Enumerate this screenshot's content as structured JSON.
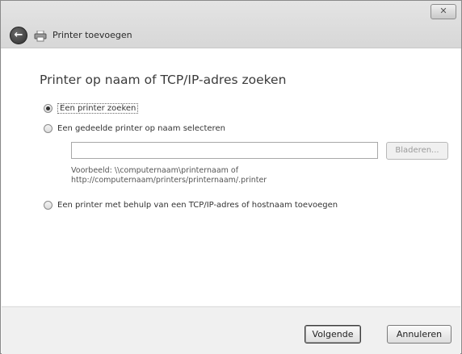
{
  "window": {
    "title": "Printer toevoegen",
    "close_glyph": "✕"
  },
  "main": {
    "heading": "Printer op naam of TCP/IP-adres zoeken",
    "options": [
      {
        "label": "Een printer zoeken",
        "selected": true
      },
      {
        "label": "Een gedeelde printer op naam selecteren",
        "selected": false
      },
      {
        "label": "Een printer met behulp van een TCP/IP-adres of hostnaam toevoegen",
        "selected": false
      }
    ],
    "path_input": {
      "value": ""
    },
    "browse_label": "Bladeren...",
    "example_line1": "Voorbeeld: \\\\computernaam\\printernaam of",
    "example_line2": "http://computernaam/printers/printernaam/.printer"
  },
  "footer": {
    "next_label": "Volgende",
    "cancel_label": "Annuleren"
  }
}
